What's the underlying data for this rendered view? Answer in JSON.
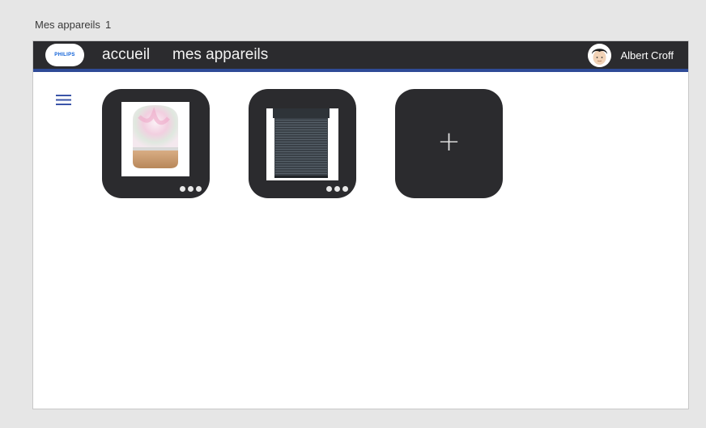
{
  "page": {
    "label": "Mes appareils",
    "count": "1"
  },
  "header": {
    "logo_text": "PHILIPS",
    "nav": [
      {
        "label": "accueil"
      },
      {
        "label": "mes appareils"
      }
    ],
    "user_name": "Albert Croff"
  },
  "devices": [
    {
      "name": "lamp-icon",
      "image": "hue-lamp"
    },
    {
      "name": "shutter-icon",
      "image": "roller-shutter"
    }
  ],
  "add_tile": {
    "label": "+"
  },
  "colors": {
    "topbar": "#2b2b2e",
    "accent_bar": "#2f4b96",
    "tile": "#2b2b2e",
    "menu_icon": "#3b55a8"
  }
}
